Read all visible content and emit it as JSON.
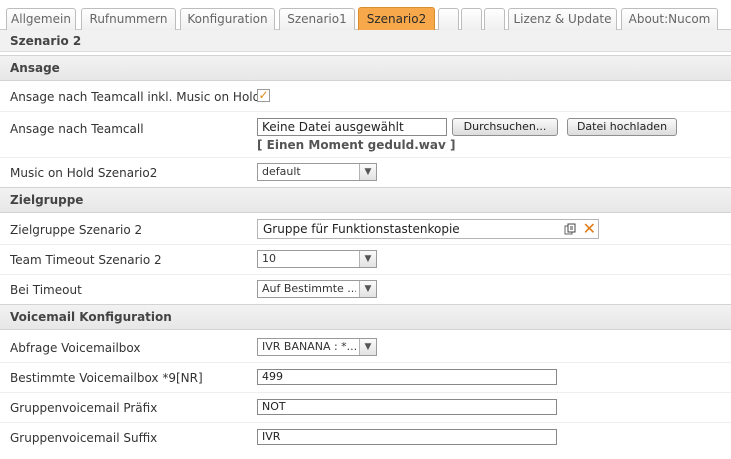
{
  "tabs": [
    {
      "label": "Allgemein",
      "active": false
    },
    {
      "label": "Rufnummern",
      "active": false
    },
    {
      "label": "Konfiguration",
      "active": false
    },
    {
      "label": "Szenario1",
      "active": false
    },
    {
      "label": "Szenario2",
      "active": true
    },
    {
      "label": "",
      "active": false
    },
    {
      "label": "",
      "active": false
    },
    {
      "label": "",
      "active": false
    },
    {
      "label": "Lizenz & Update",
      "active": false
    },
    {
      "label": "About:Nucom",
      "active": false
    }
  ],
  "page_title": "Szenario 2",
  "sections": {
    "ansage": "Ansage",
    "zielgruppe": "Zielgruppe",
    "voicemail": "Voicemail Konfiguration"
  },
  "fields": {
    "teamcall_moh": {
      "label": "Ansage nach Teamcall inkl. Music on Hold",
      "checked": true,
      "check_mark": "✓"
    },
    "ansage_teamcall": {
      "label": "Ansage nach Teamcall",
      "file_status": "Keine Datei ausgewählt",
      "browse_label": "Durchsuchen...",
      "upload_label": "Datei hochladen",
      "current_file": "[ Einen Moment geduld.wav ]"
    },
    "moh_szenario2": {
      "label": "Music on Hold Szenario2",
      "value": "default"
    },
    "zielgruppe": {
      "label": "Zielgruppe Szenario 2",
      "value": "Gruppe für Funktionstastenkopie",
      "remove_glyph": "✕"
    },
    "team_timeout": {
      "label": "Team Timeout Szenario 2",
      "value": "10"
    },
    "bei_timeout": {
      "label": "Bei Timeout",
      "value": "Auf Bestimmte ..."
    },
    "abfrage_voicemailbox": {
      "label": "Abfrage Voicemailbox",
      "value": "IVR BANANA : *..."
    },
    "bestimmte_voicemailbox": {
      "label": "Bestimmte Voicemailbox *9[NR]",
      "value": "499"
    },
    "gruppen_praefix": {
      "label": "Gruppenvoicemail Präfix",
      "value": "NOT"
    },
    "gruppen_suffix": {
      "label": "Gruppenvoicemail Suffix",
      "value": "IVR"
    }
  },
  "select_arrow": "▼",
  "colors": {
    "active_tab": "#f7a84a",
    "accent_orange": "#e07b14"
  }
}
